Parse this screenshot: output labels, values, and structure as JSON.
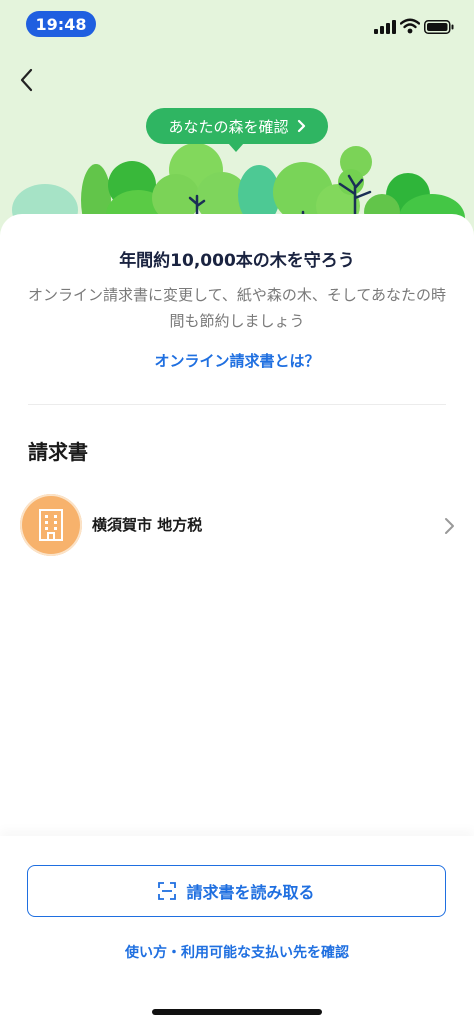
{
  "status_bar": {
    "time": "19:48",
    "icons": [
      "signal-icon",
      "wifi-icon",
      "battery-icon"
    ]
  },
  "header": {
    "back_icon": "chevron-left-icon",
    "forest_button_label": "あなたの森を確認",
    "forest_button_icon": "chevron-right-icon"
  },
  "promo": {
    "headline": "年間約10,000本の木を守ろう",
    "description": "オンライン請求書に変更して、紙や森の木、そしてあなたの時間も節約しましょう",
    "link_label": "オンライン請求書とは？"
  },
  "invoices": {
    "section_title": "請求書",
    "items": [
      {
        "name": "横須賀市 地方税",
        "icon": "building-icon",
        "avatar_color": "#f7b26c"
      }
    ]
  },
  "actions": {
    "scan_label": "請求書を読み取る",
    "scan_icon": "scan-icon",
    "help_label": "使い方・利用可能な支払い先を確認"
  },
  "colors": {
    "accent": "#1f6fe0",
    "forest_green": "#2fb562",
    "hero_bg": "#e4f4dc",
    "time_pill": "#1f5fe0"
  }
}
